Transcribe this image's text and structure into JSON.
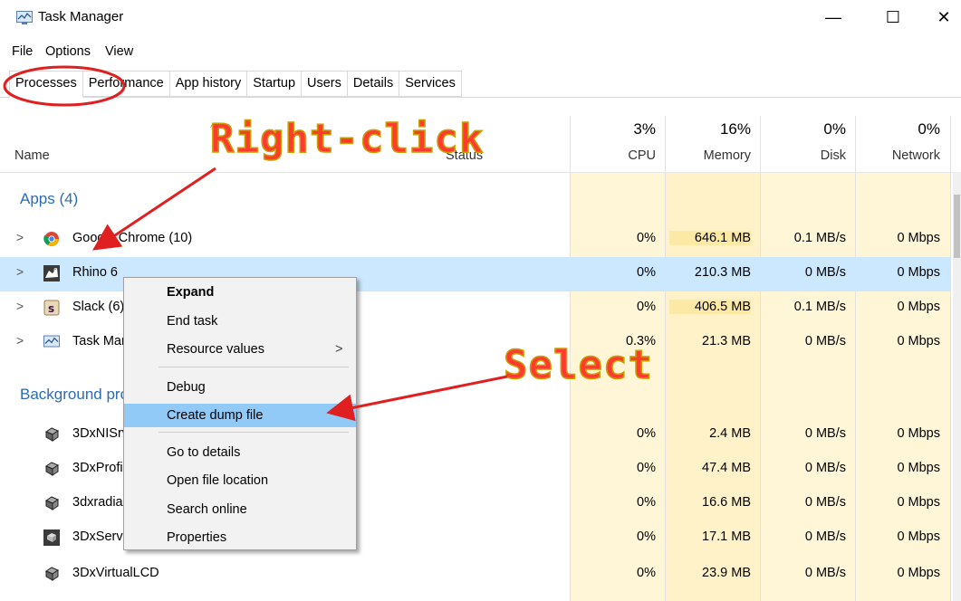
{
  "window": {
    "title": "Task Manager",
    "minimize": "—",
    "maximize": "☐",
    "close": "✕"
  },
  "menu": [
    "File",
    "Options",
    "View"
  ],
  "tabs": [
    "Processes",
    "Performance",
    "App history",
    "Startup",
    "Users",
    "Details",
    "Services"
  ],
  "columns": {
    "name": "Name",
    "status": "Status",
    "cpu": {
      "pct": "3%",
      "label": "CPU"
    },
    "memory": {
      "pct": "16%",
      "label": "Memory"
    },
    "disk": {
      "pct": "0%",
      "label": "Disk"
    },
    "network": {
      "pct": "0%",
      "label": "Network"
    }
  },
  "groups": {
    "apps": "Apps (4)",
    "background": "Background processes"
  },
  "apps": [
    {
      "name": "Google Chrome (10)",
      "cpu": "0%",
      "memory": "646.1 MB",
      "disk": "0.1 MB/s",
      "network": "0 Mbps",
      "icon": "chrome-icon"
    },
    {
      "name": "Rhino 6",
      "cpu": "0%",
      "memory": "210.3 MB",
      "disk": "0 MB/s",
      "network": "0 Mbps",
      "icon": "rhino-icon"
    },
    {
      "name": "Slack (6)",
      "cpu": "0%",
      "memory": "406.5 MB",
      "disk": "0.1 MB/s",
      "network": "0 Mbps",
      "icon": "slack-icon"
    },
    {
      "name": "Task Manager",
      "cpu": "0.3%",
      "memory": "21.3 MB",
      "disk": "0 MB/s",
      "network": "0 Mbps",
      "icon": "task-manager-icon"
    }
  ],
  "background": [
    {
      "name": "3DxNISrv",
      "cpu": "0%",
      "memory": "2.4 MB",
      "disk": "0 MB/s",
      "network": "0 Mbps"
    },
    {
      "name": "3DxProfileServer",
      "cpu": "0%",
      "memory": "47.4 MB",
      "disk": "0 MB/s",
      "network": "0 Mbps"
    },
    {
      "name": "3dxradiald",
      "cpu": "0%",
      "memory": "16.6 MB",
      "disk": "0 MB/s",
      "network": "0 Mbps"
    },
    {
      "name": "3DxService",
      "cpu": "0%",
      "memory": "17.1 MB",
      "disk": "0 MB/s",
      "network": "0 Mbps"
    },
    {
      "name": "3DxVirtualLCD",
      "cpu": "0%",
      "memory": "23.9 MB",
      "disk": "0 MB/s",
      "network": "0 Mbps"
    }
  ],
  "context_menu": {
    "expand": "Expand",
    "end_task": "End task",
    "resource_values": "Resource values",
    "submenu_arrow": ">",
    "debug": "Debug",
    "create_dump": "Create dump file",
    "go_to_details": "Go to details",
    "open_file_location": "Open file location",
    "search_online": "Search online",
    "properties": "Properties"
  },
  "annotations": {
    "right_click": "Right-click",
    "select": "Select"
  },
  "colors": {
    "annotation": "#e02020",
    "selected_row": "#cce8ff",
    "menu_highlight": "#91c9f7",
    "heat": "#fff4c4",
    "group": "#2c6bb5"
  }
}
